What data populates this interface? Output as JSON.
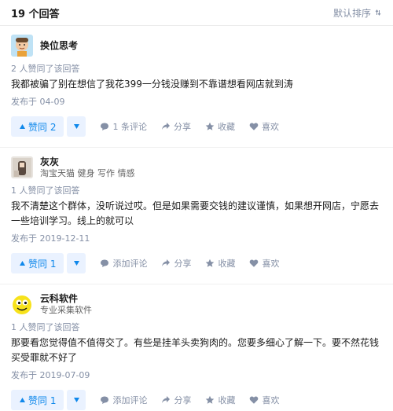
{
  "header": {
    "count_label": "19 个回答",
    "sort_label": "默认排序"
  },
  "answers": [
    {
      "author_name": "换位思考",
      "author_bio": "",
      "voters": "2 人赞同了该回答",
      "content": "我都被骗了别在想信了我花399一分钱没赚到不靠谱想看网店就到涛",
      "date": "发布于 04-09",
      "vote_label": "赞同 2",
      "comment_label": "1 条评论",
      "share_label": "分享",
      "favorite_label": "收藏",
      "like_label": "喜欢"
    },
    {
      "author_name": "灰灰",
      "author_bio": "淘宝天猫 健身 写作 情感",
      "voters": "1 人赞同了该回答",
      "content": "我不清楚这个群体，没听说过哎。但是如果需要交钱的建议谨慎，如果想开网店，宁愿去一些培训学习。线上的就可以",
      "date": "发布于 2019-12-11",
      "vote_label": "赞同 1",
      "comment_label": "添加评论",
      "share_label": "分享",
      "favorite_label": "收藏",
      "like_label": "喜欢"
    },
    {
      "author_name": "云科软件",
      "author_bio": "专业采集软件",
      "voters": "1 人赞同了该回答",
      "content": "那要看您觉得值不值得交了。有些是挂羊头卖狗肉的。您要多细心了解一下。要不然花钱买受罪就不好了",
      "date": "发布于 2019-07-09",
      "vote_label": "赞同 1",
      "comment_label": "添加评论",
      "share_label": "分享",
      "favorite_label": "收藏",
      "like_label": "喜欢"
    }
  ],
  "colors": {
    "accent": "#0f88eb",
    "vote_bg": "#eaf2ff",
    "meta": "#8590a6"
  }
}
